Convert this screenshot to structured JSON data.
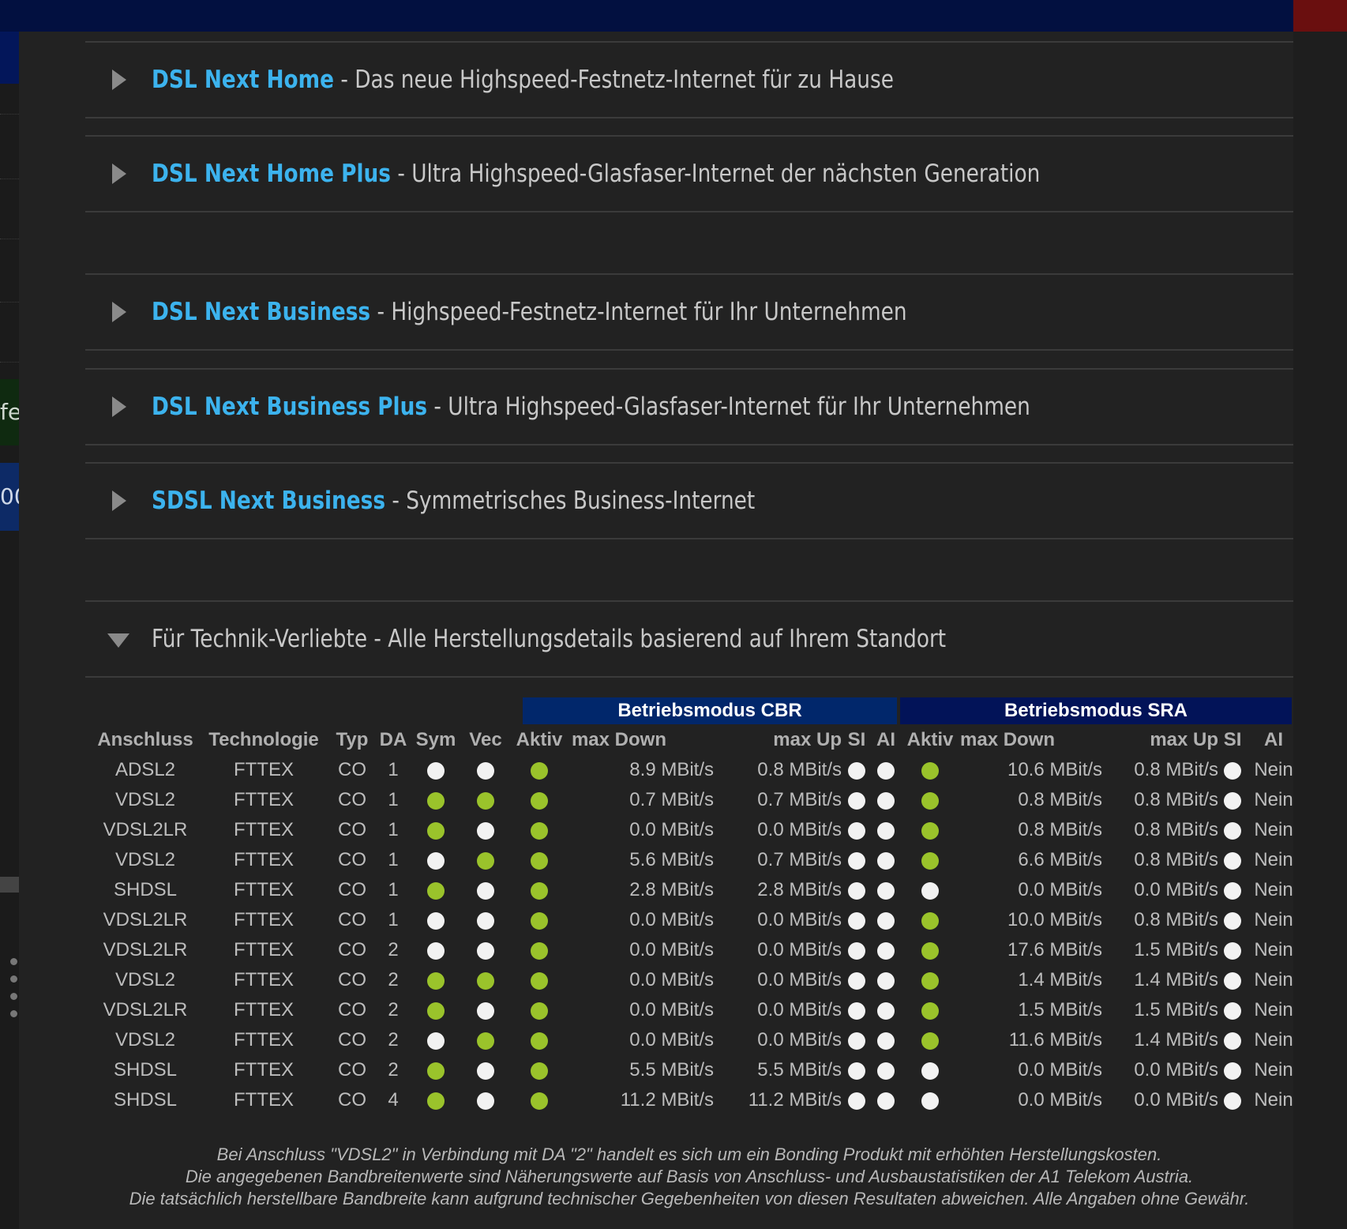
{
  "left_fragments": {
    "green": "fe",
    "blue": "00"
  },
  "panels": [
    {
      "name": "DSL Next Home",
      "sep": " - ",
      "desc": "Das neue Highspeed-Festnetz-Internet für zu Hause"
    },
    {
      "name": "DSL Next Home Plus",
      "sep": " - ",
      "desc": "Ultra Highspeed-Glasfaser-Internet der nächsten Generation"
    },
    {
      "name": "DSL Next Business",
      "sep": " - ",
      "desc": "Highspeed-Festnetz-Internet für Ihr Unternehmen"
    },
    {
      "name": "DSL Next Business Plus",
      "sep": " - ",
      "desc": "Ultra Highspeed-Glasfaser-Internet für Ihr Unternehmen"
    },
    {
      "name": "SDSL Next Business",
      "sep": " - ",
      "desc": "Symmetrisches Business-Internet"
    }
  ],
  "tech_panel": {
    "title": "Für Technik-Verliebte - Alle Herstellungsdetails basierend auf Ihrem Standort"
  },
  "bands": {
    "cbr": "Betriebsmodus CBR",
    "sra": "Betriebsmodus SRA"
  },
  "columns": [
    "Anschluss",
    "Technologie",
    "Typ",
    "DA",
    "Sym",
    "Vec",
    "Aktiv",
    "max Down",
    "max Up",
    "SI",
    "AI",
    "Aktiv",
    "max Down",
    "max Up",
    "SI",
    "AI"
  ],
  "status_colors": {
    "active": "#9ac32b",
    "inactive": "#f2f2f2"
  },
  "rows": [
    {
      "anschluss": "ADSL2",
      "tech": "FTTEX",
      "typ": "CO",
      "da": "1",
      "sym": "w",
      "vec": "w",
      "aktiv": "g",
      "down": "8.9 MBit/s",
      "up": "0.8 MBit/s",
      "si": "w",
      "ai": "w",
      "sra_aktiv": "g",
      "sra_down": "10.6 MBit/s",
      "sra_up": "0.8 MBit/s",
      "sra_si": "w",
      "sra_ai": "Nein"
    },
    {
      "anschluss": "VDSL2",
      "tech": "FTTEX",
      "typ": "CO",
      "da": "1",
      "sym": "g",
      "vec": "g",
      "aktiv": "g",
      "down": "0.7 MBit/s",
      "up": "0.7 MBit/s",
      "si": "w",
      "ai": "w",
      "sra_aktiv": "g",
      "sra_down": "0.8 MBit/s",
      "sra_up": "0.8 MBit/s",
      "sra_si": "w",
      "sra_ai": "Nein"
    },
    {
      "anschluss": "VDSL2LR",
      "tech": "FTTEX",
      "typ": "CO",
      "da": "1",
      "sym": "g",
      "vec": "w",
      "aktiv": "g",
      "down": "0.0 MBit/s",
      "up": "0.0 MBit/s",
      "si": "w",
      "ai": "w",
      "sra_aktiv": "g",
      "sra_down": "0.8 MBit/s",
      "sra_up": "0.8 MBit/s",
      "sra_si": "w",
      "sra_ai": "Nein"
    },
    {
      "anschluss": "VDSL2",
      "tech": "FTTEX",
      "typ": "CO",
      "da": "1",
      "sym": "w",
      "vec": "g",
      "aktiv": "g",
      "down": "5.6 MBit/s",
      "up": "0.7 MBit/s",
      "si": "w",
      "ai": "w",
      "sra_aktiv": "g",
      "sra_down": "6.6 MBit/s",
      "sra_up": "0.8 MBit/s",
      "sra_si": "w",
      "sra_ai": "Nein"
    },
    {
      "anschluss": "SHDSL",
      "tech": "FTTEX",
      "typ": "CO",
      "da": "1",
      "sym": "g",
      "vec": "w",
      "aktiv": "g",
      "down": "2.8 MBit/s",
      "up": "2.8 MBit/s",
      "si": "w",
      "ai": "w",
      "sra_aktiv": "w",
      "sra_down": "0.0 MBit/s",
      "sra_up": "0.0 MBit/s",
      "sra_si": "w",
      "sra_ai": "Nein"
    },
    {
      "anschluss": "VDSL2LR",
      "tech": "FTTEX",
      "typ": "CO",
      "da": "1",
      "sym": "w",
      "vec": "w",
      "aktiv": "g",
      "down": "0.0 MBit/s",
      "up": "0.0 MBit/s",
      "si": "w",
      "ai": "w",
      "sra_aktiv": "g",
      "sra_down": "10.0 MBit/s",
      "sra_up": "0.8 MBit/s",
      "sra_si": "w",
      "sra_ai": "Nein"
    },
    {
      "anschluss": "VDSL2LR",
      "tech": "FTTEX",
      "typ": "CO",
      "da": "2",
      "sym": "w",
      "vec": "w",
      "aktiv": "g",
      "down": "0.0 MBit/s",
      "up": "0.0 MBit/s",
      "si": "w",
      "ai": "w",
      "sra_aktiv": "g",
      "sra_down": "17.6 MBit/s",
      "sra_up": "1.5 MBit/s",
      "sra_si": "w",
      "sra_ai": "Nein"
    },
    {
      "anschluss": "VDSL2",
      "tech": "FTTEX",
      "typ": "CO",
      "da": "2",
      "sym": "g",
      "vec": "g",
      "aktiv": "g",
      "down": "0.0 MBit/s",
      "up": "0.0 MBit/s",
      "si": "w",
      "ai": "w",
      "sra_aktiv": "g",
      "sra_down": "1.4 MBit/s",
      "sra_up": "1.4 MBit/s",
      "sra_si": "w",
      "sra_ai": "Nein"
    },
    {
      "anschluss": "VDSL2LR",
      "tech": "FTTEX",
      "typ": "CO",
      "da": "2",
      "sym": "g",
      "vec": "w",
      "aktiv": "g",
      "down": "0.0 MBit/s",
      "up": "0.0 MBit/s",
      "si": "w",
      "ai": "w",
      "sra_aktiv": "g",
      "sra_down": "1.5 MBit/s",
      "sra_up": "1.5 MBit/s",
      "sra_si": "w",
      "sra_ai": "Nein"
    },
    {
      "anschluss": "VDSL2",
      "tech": "FTTEX",
      "typ": "CO",
      "da": "2",
      "sym": "w",
      "vec": "g",
      "aktiv": "g",
      "down": "0.0 MBit/s",
      "up": "0.0 MBit/s",
      "si": "w",
      "ai": "w",
      "sra_aktiv": "g",
      "sra_down": "11.6 MBit/s",
      "sra_up": "1.4 MBit/s",
      "sra_si": "w",
      "sra_ai": "Nein"
    },
    {
      "anschluss": "SHDSL",
      "tech": "FTTEX",
      "typ": "CO",
      "da": "2",
      "sym": "g",
      "vec": "w",
      "aktiv": "g",
      "down": "5.5 MBit/s",
      "up": "5.5 MBit/s",
      "si": "w",
      "ai": "w",
      "sra_aktiv": "w",
      "sra_down": "0.0 MBit/s",
      "sra_up": "0.0 MBit/s",
      "sra_si": "w",
      "sra_ai": "Nein"
    },
    {
      "anschluss": "SHDSL",
      "tech": "FTTEX",
      "typ": "CO",
      "da": "4",
      "sym": "g",
      "vec": "w",
      "aktiv": "g",
      "down": "11.2 MBit/s",
      "up": "11.2 MBit/s",
      "si": "w",
      "ai": "w",
      "sra_aktiv": "w",
      "sra_down": "0.0 MBit/s",
      "sra_up": "0.0 MBit/s",
      "sra_si": "w",
      "sra_ai": "Nein"
    }
  ],
  "footnote": [
    "Bei Anschluss \"VDSL2\" in Verbindung mit DA \"2\" handelt es sich um ein Bonding Produkt mit erhöhten Herstellungskosten.",
    "Die angegebenen Bandbreitenwerte sind Näherungswerte auf Basis von Anschluss- und Ausbaustatistiken der A1 Telekom Austria.",
    "Die tatsächlich herstellbare Bandbreite kann aufgrund technischer Gegebenheiten von diesen Resultaten abweichen. Alle Angaben ohne Gewähr."
  ]
}
